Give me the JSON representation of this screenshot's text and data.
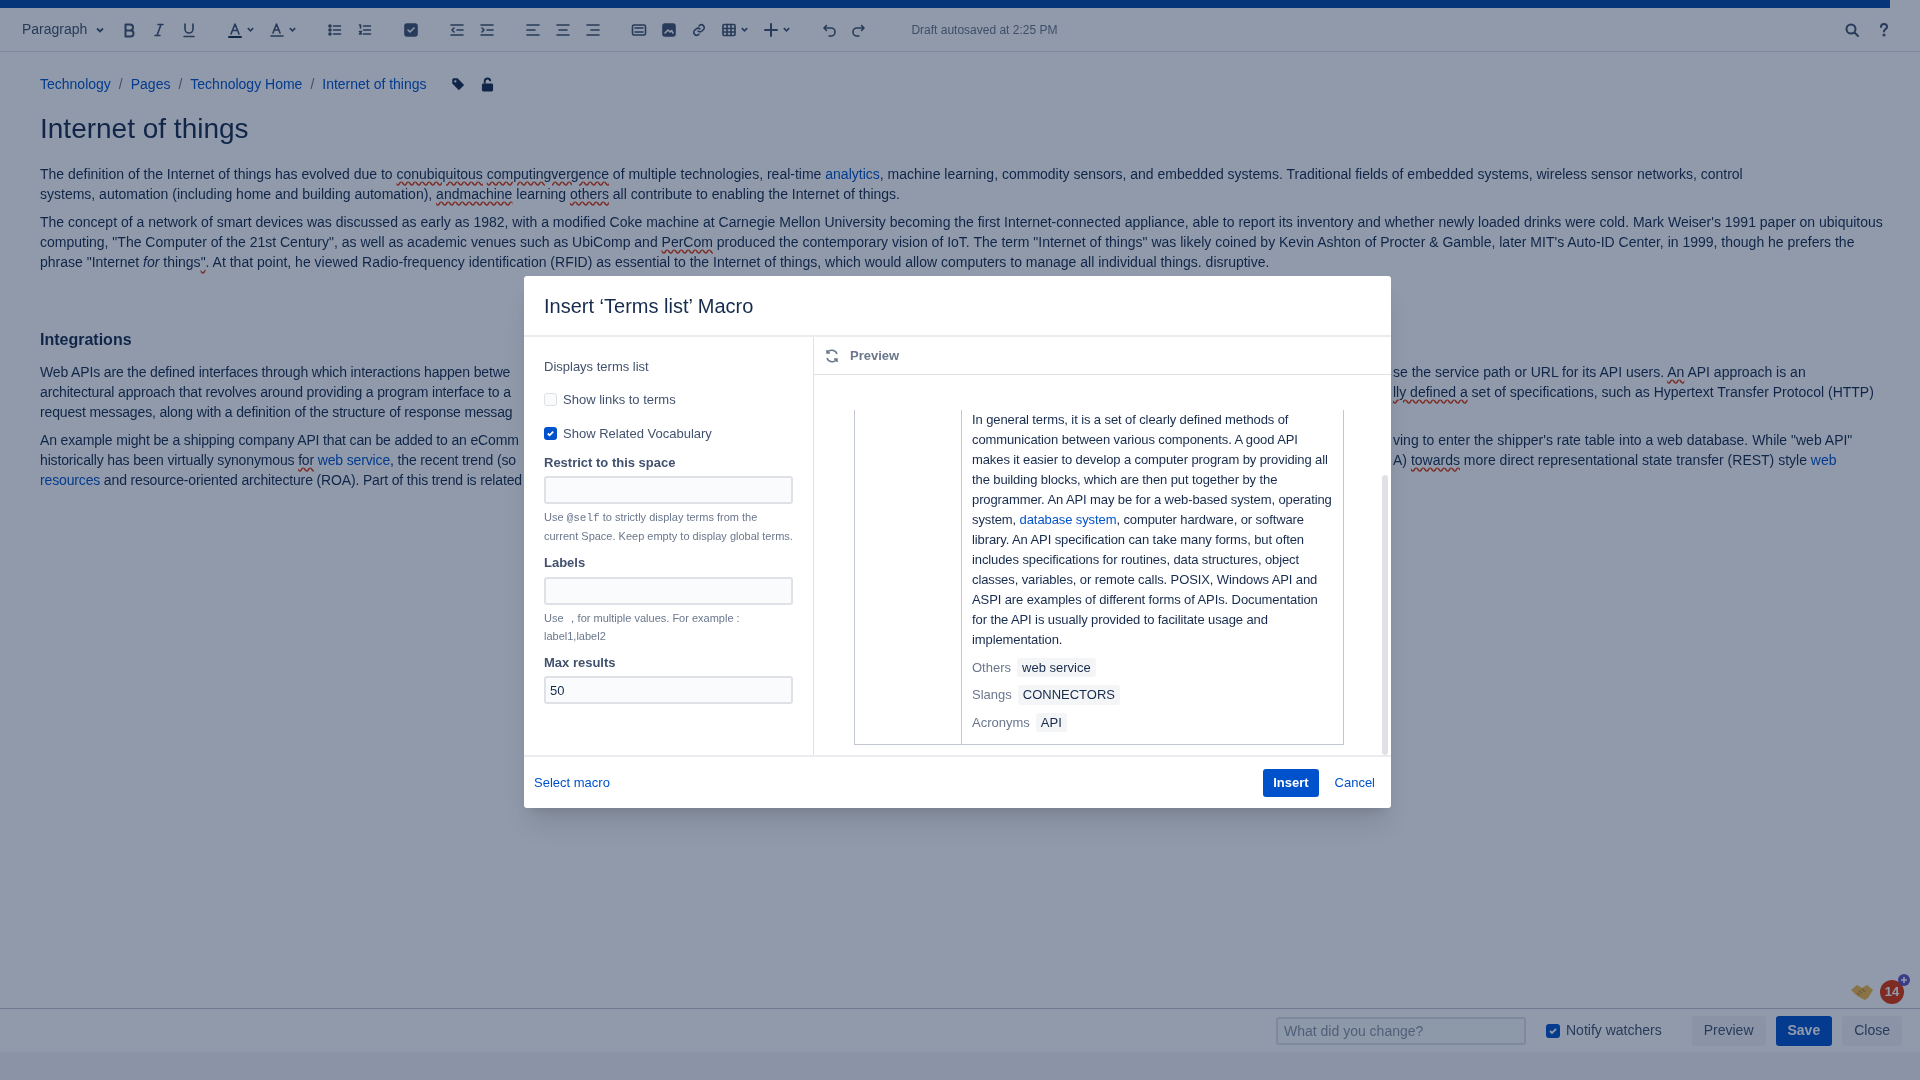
{
  "toolbar": {
    "style_select": "Paragraph",
    "status": "Draft autosaved at 2:25 PM"
  },
  "breadcrumbs": {
    "separator": "/",
    "items": [
      "Technology",
      "Pages",
      "Technology Home",
      "Internet of things"
    ]
  },
  "page": {
    "title": "Internet of things",
    "intro_paragraphs": [
      {
        "lines": [
          [
            {
              "kind": "text",
              "text": "The definition of the Internet of things has evolved due to "
            },
            {
              "kind": "misspelled",
              "text": "conubiquitous"
            },
            {
              "kind": "misspelled",
              "text": "computingvergence",
              "space_before": true
            },
            {
              "kind": "text",
              "text": " of multiple technologies, real-time "
            },
            {
              "kind": "link",
              "text": "analytics"
            },
            {
              "kind": "text",
              "text": ", machine learning, commodity sensors, and embedded systems. Traditional fields of embedded systems, wireless sensor networks, control"
            }
          ],
          [
            {
              "kind": "text",
              "text": "systems, automation (including home and building automation), "
            },
            {
              "kind": "misspelled",
              "text": "andmachine"
            },
            {
              "kind": "text",
              "text": " learning "
            },
            {
              "kind": "misspelled",
              "text": "others"
            },
            {
              "kind": "text",
              "text": " all contribute to enabling the Internet of things."
            }
          ]
        ]
      },
      {
        "lines": [
          [
            {
              "kind": "text",
              "text": "The concept of a network of smart devices was discussed as early as 1982, with a modified Coke machine at Carnegie Mellon University becoming the first Internet-connected appliance, able to report its inventory and whether newly loaded drinks were cold. Mark Weiser's 1991 paper on ubiquitous"
            }
          ],
          [
            {
              "kind": "text",
              "text": "computing, \"The Computer of the 21st Century\", as well as academic venues such as UbiComp and "
            },
            {
              "kind": "misspelled",
              "text": "PerCom"
            },
            {
              "kind": "text",
              "text": " produced the contemporary vision of IoT. The term \"Internet of things\" was likely coined by Kevin Ashton of Procter & Gamble, later MIT's Auto-ID Center, in 1999, though he prefers the"
            }
          ],
          [
            {
              "kind": "text",
              "text": "phrase \"Internet "
            },
            {
              "kind": "italic",
              "text": "for"
            },
            {
              "kind": "text",
              "text": " things"
            },
            {
              "kind": "misspelled",
              "text": "\""
            },
            {
              "kind": "text",
              "text": ". At that point, he viewed Radio-frequency identification (RFID) as essential to the Internet of things, which would allow computers to manage all individual things. disruptive."
            }
          ]
        ]
      }
    ],
    "heading": "Integrations",
    "cut_paragraphs": [
      {
        "lines": [
          {
            "left": [
              {
                "kind": "text",
                "text": "Web APIs are the defined interfaces through which interactions happen betwe"
              }
            ],
            "right": [
              {
                "kind": "text",
                "text": "se the service path or URL for its API users. "
              },
              {
                "kind": "misspelled",
                "text": "An"
              },
              {
                "kind": "text",
                "text": " API approach is an"
              }
            ]
          },
          {
            "left": [
              {
                "kind": "text",
                "text": "architectural approach that revolves around providing a program interface to a"
              }
            ],
            "right": [
              {
                "kind": "misspelled",
                "text": "lly defined a"
              },
              {
                "kind": "text",
                "text": " set of specifications, such as Hypertext Transfer Protocol (HTTP)"
              }
            ]
          },
          {
            "left": [
              {
                "kind": "text",
                "text": "request messages, along with a definition of the structure of response messag"
              }
            ]
          }
        ]
      },
      {
        "lines": [
          {
            "left": [
              {
                "kind": "text",
                "text": "An example might be a shipping company API that can be added to an eComm"
              }
            ],
            "right": [
              {
                "kind": "text",
                "text": "ving to enter the shipper's rate table into a web database. While \"web API\""
              }
            ]
          },
          {
            "left": [
              {
                "kind": "text",
                "text": "historically has been virtually synonymous "
              },
              {
                "kind": "misspelled",
                "text": "for"
              },
              {
                "kind": "link",
                "text": "web service",
                "space_before": true
              },
              {
                "kind": "text",
                "text": ", the recent trend (so"
              }
            ],
            "right": [
              {
                "kind": "text",
                "text": "A) "
              },
              {
                "kind": "misspelled",
                "text": "towards"
              },
              {
                "kind": "text",
                "text": " more direct representational state transfer (REST) style "
              },
              {
                "kind": "link",
                "text": "web"
              }
            ]
          },
          {
            "left": [
              {
                "kind": "link",
                "text": "resources"
              },
              {
                "kind": "text",
                "text": " and resource-oriented architecture (ROA). Part of this trend is related"
              }
            ]
          }
        ]
      }
    ]
  },
  "dialog": {
    "title": "Insert ‘Terms list’ Macro",
    "description": "Displays terms list",
    "options": [
      {
        "label": "Show links to terms",
        "checked": false
      },
      {
        "label": "Show Related Vocabulary",
        "checked": true
      }
    ],
    "fields": [
      {
        "label": "Restrict to this space",
        "hint": [
          {
            "kind": "text",
            "text": "Use "
          },
          {
            "kind": "code",
            "text": "@self"
          },
          {
            "kind": "text",
            "text": " to strictly display terms from the current Space. Keep empty to display global terms."
          }
        ]
      },
      {
        "label": "Labels",
        "hint": [
          {
            "kind": "text",
            "text": "Use ，for multiple values. For example : label1,label2"
          }
        ]
      },
      {
        "label": "Max results",
        "value": "50"
      }
    ],
    "preview": {
      "title": "Preview",
      "definition": [
        {
          "kind": "text",
          "text": "In general terms, it is a set of clearly defined methods of communication between various components. A good API makes it easier to develop a computer program by providing all the building blocks, which are then put together by the programmer. An API may be for a web-based system, operating system, "
        },
        {
          "kind": "link",
          "text": "database system"
        },
        {
          "kind": "text",
          "text": ", computer hardware, or software library. An API specification can take many forms, but often includes specifications for routines, data structures, object classes, variables, or remote calls. POSIX, Windows API and ASPI are examples of different forms of APIs. Documentation for the API is usually provided to facilitate usage and implementation."
        }
      ],
      "related": [
        {
          "label": "Others",
          "tags": [
            "web service"
          ]
        },
        {
          "label": "Slangs",
          "tags": [
            "CONNECTORS"
          ]
        },
        {
          "label": "Acronyms",
          "tags": [
            "API"
          ]
        }
      ]
    },
    "select_link": "Select macro",
    "buttons": [
      {
        "label": "Insert",
        "kind": "primary"
      },
      {
        "label": "Cancel",
        "kind": "link"
      }
    ]
  },
  "footer": {
    "comment_placeholder": "What did you change?",
    "notify": {
      "label": "Notify watchers",
      "checked": true
    },
    "buttons": [
      {
        "label": "Preview",
        "kind": "default"
      },
      {
        "label": "Save",
        "kind": "primary"
      },
      {
        "label": "Close",
        "kind": "default"
      }
    ],
    "badge": "14"
  }
}
